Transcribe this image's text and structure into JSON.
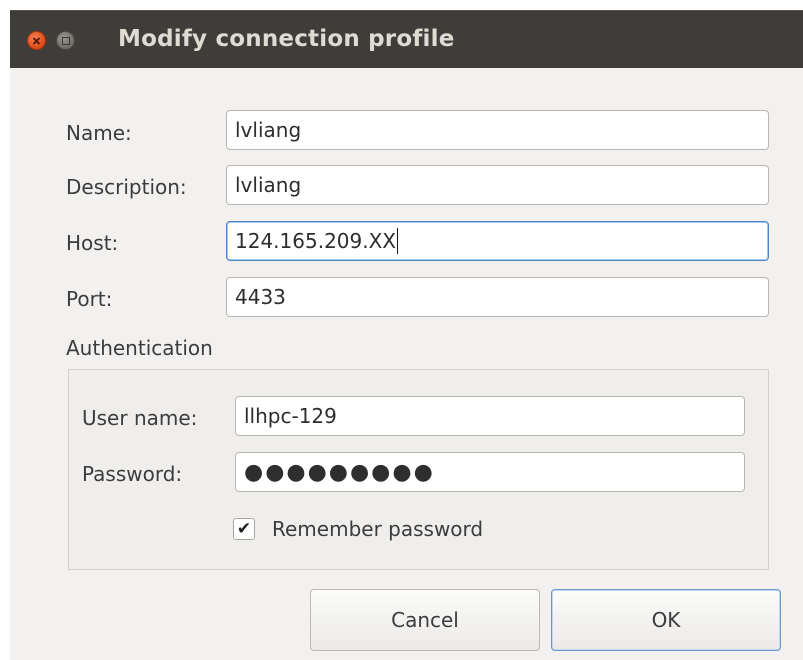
{
  "window": {
    "title": "Modify connection profile"
  },
  "form": {
    "name_label": "Name:",
    "name_value": "lvliang",
    "description_label": "Description:",
    "description_value": "lvliang",
    "host_label": "Host:",
    "host_value": "124.165.209.XX",
    "port_label": "Port:",
    "port_value": "4433"
  },
  "authentication": {
    "section_title": "Authentication",
    "username_label": "User name:",
    "username_value": "llhpc-129",
    "password_label": "Password:",
    "password_mask": "●●●●●●●●●",
    "remember_label": "Remember password",
    "remember_checked": true,
    "checkmark": "✔"
  },
  "buttons": {
    "cancel_label": "Cancel",
    "ok_label": "OK"
  },
  "colors": {
    "titlebar": "#3f3d39",
    "dialog_bg": "#f2f1f0",
    "focus_border": "#4c87c8",
    "close_button": "#dd4814"
  }
}
